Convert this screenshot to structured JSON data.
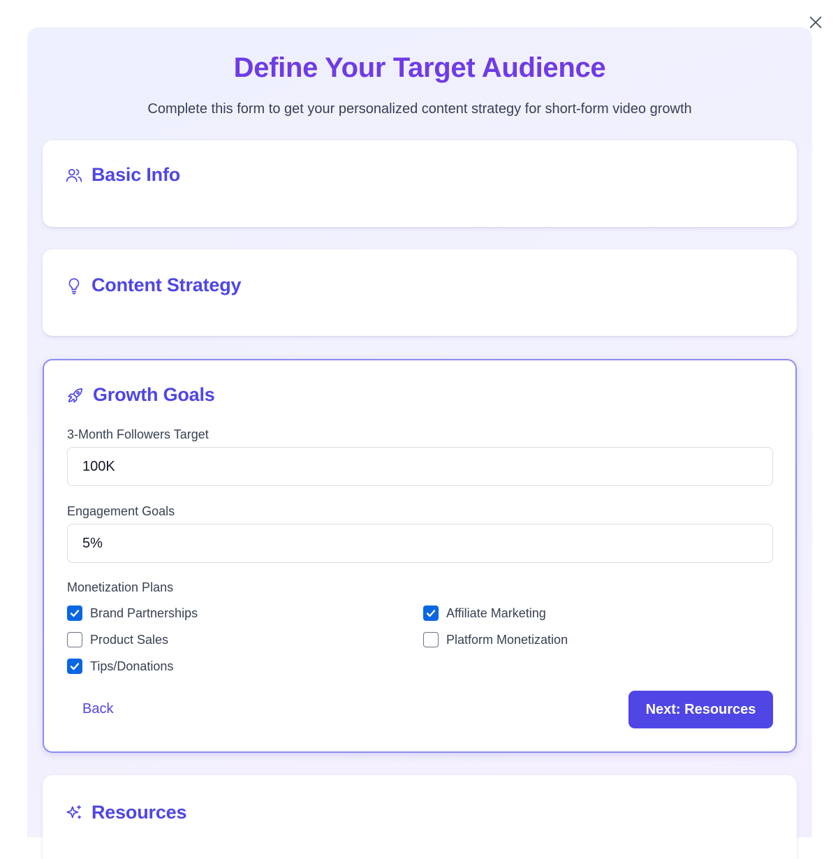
{
  "header": {
    "title": "Define Your Target Audience",
    "subtitle": "Complete this form to get your personalized content strategy for short-form video growth"
  },
  "sections": {
    "basic_info": {
      "title": "Basic Info",
      "icon": "users-icon"
    },
    "content_strategy": {
      "title": "Content Strategy",
      "icon": "lightbulb-icon"
    },
    "growth_goals": {
      "title": "Growth Goals",
      "icon": "rocket-icon",
      "followers_label": "3-Month Followers Target",
      "followers_value": "100K",
      "engagement_label": "Engagement Goals",
      "engagement_value": "5%",
      "monetization_label": "Monetization Plans",
      "monetization_options": [
        {
          "label": "Brand Partnerships",
          "checked": true
        },
        {
          "label": "Affiliate Marketing",
          "checked": true
        },
        {
          "label": "Product Sales",
          "checked": false
        },
        {
          "label": "Platform Monetization",
          "checked": false
        },
        {
          "label": "Tips/Donations",
          "checked": true
        }
      ],
      "back_label": "Back",
      "next_label": "Next: Resources"
    },
    "resources": {
      "title": "Resources",
      "icon": "sparkles-icon"
    }
  },
  "colors": {
    "title": "#6f3be6",
    "accent": "#4f46e5",
    "checkbox": "#0b66e4",
    "active_border": "#8b8cf0"
  }
}
